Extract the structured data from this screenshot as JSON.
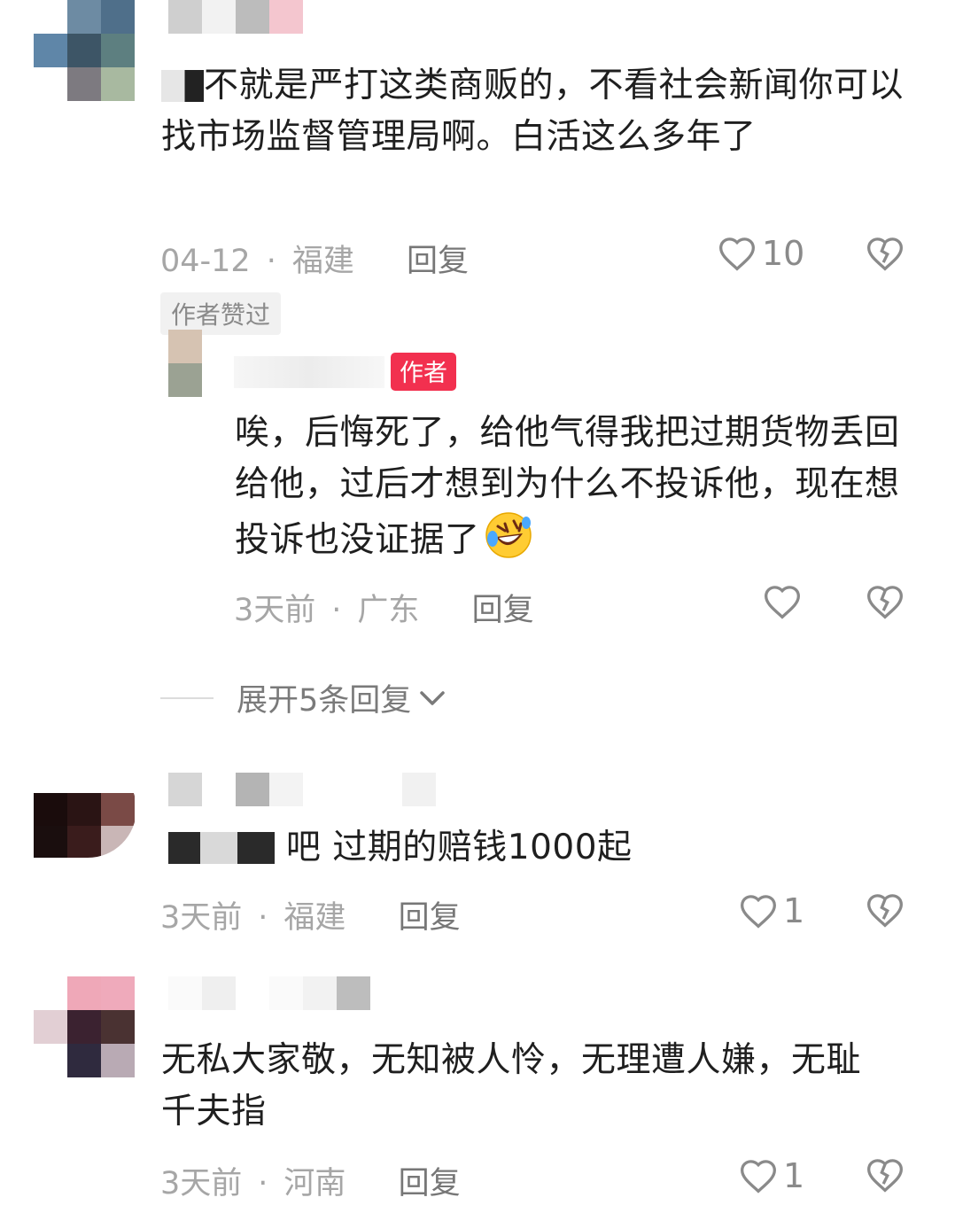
{
  "comments": [
    {
      "text_prefix_masked": "不就是严打这类商贩的，不看社会新闻你可以找市场监督管理局啊。白活这么多年了",
      "date": "04-12",
      "location": "福建",
      "reply_label": "回复",
      "likes": "10",
      "author_liked_badge": "作者赞过"
    },
    {
      "author_tag": "作者",
      "text": "唉，后悔死了，给他气得我把过期货物丢回给他，过后才想到为什么不投诉他，现在想投诉也没证据了",
      "emoji_name": "rolling-on-floor-laughing-emoji",
      "date": "3天前",
      "location": "广东",
      "reply_label": "回复",
      "likes": ""
    },
    {
      "expand_label": "展开5条回复"
    },
    {
      "text": "吧 过期的赔钱1000起",
      "date": "3天前",
      "location": "福建",
      "reply_label": "回复",
      "likes": "1"
    },
    {
      "text": "无私大家敬，无知被人怜，无理遭人嫌，无耻千夫指",
      "date": "3天前",
      "location": "河南",
      "reply_label": "回复",
      "likes": "1"
    }
  ],
  "meta_separator": "·",
  "colors": {
    "author_tag": "#f2304f",
    "meta": "#a6a6a6",
    "text": "#1f1f1f"
  },
  "icons": {
    "like": "heart-outline-icon",
    "dislike": "broken-heart-icon",
    "expand": "chevron-down-icon"
  }
}
